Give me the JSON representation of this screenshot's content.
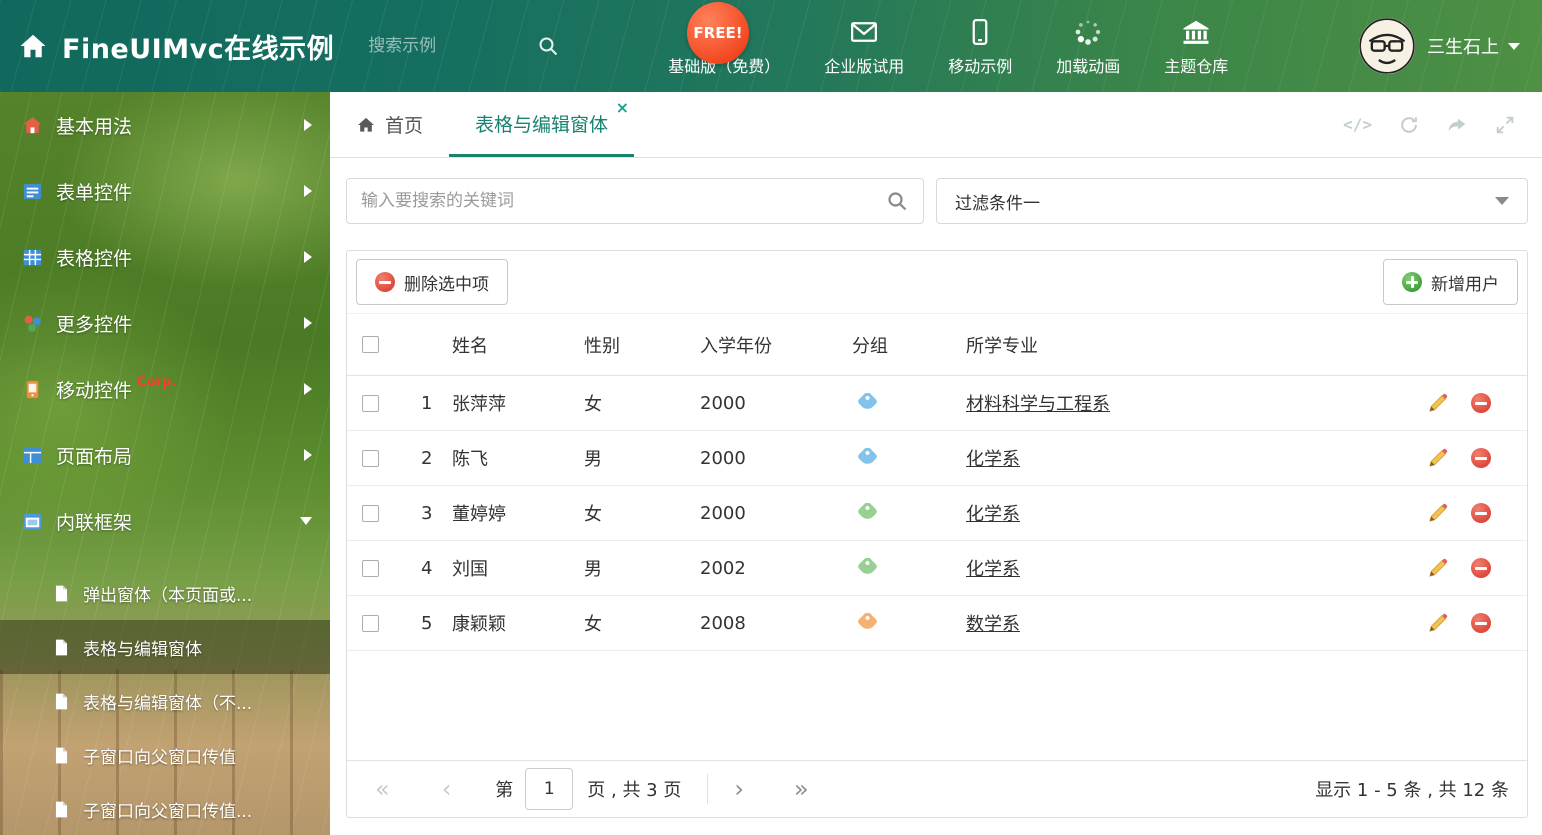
{
  "colors": {
    "accent": "#18836f",
    "header_green": "#156e60",
    "delete_red": "#dd4538",
    "add_green": "#46a443"
  },
  "header": {
    "title": "FineUIMvc在线示例",
    "search_placeholder": "搜索示例",
    "free_badge": "FREE!",
    "menu": [
      {
        "label": "基础版（免费）",
        "icon": "download-icon"
      },
      {
        "label": "企业版试用",
        "icon": "envelope-icon"
      },
      {
        "label": "移动示例",
        "icon": "mobile-icon"
      },
      {
        "label": "加载动画",
        "icon": "spinner-icon"
      },
      {
        "label": "主题仓库",
        "icon": "bank-icon"
      }
    ],
    "user": {
      "name": "三生石上"
    }
  },
  "sidebar": {
    "items": [
      {
        "label": "基本用法",
        "icon": "home-icon"
      },
      {
        "label": "表单控件",
        "icon": "form-icon"
      },
      {
        "label": "表格控件",
        "icon": "table-icon"
      },
      {
        "label": "更多控件",
        "icon": "widgets-icon"
      },
      {
        "label": "移动控件",
        "icon": "mobile-icon",
        "badge": "Corp."
      },
      {
        "label": "页面布局",
        "icon": "layout-icon"
      },
      {
        "label": "内联框架",
        "icon": "iframe-icon"
      }
    ],
    "subitems": [
      {
        "label": "弹出窗体（本页面或..."
      },
      {
        "label": "表格与编辑窗体"
      },
      {
        "label": "表格与编辑窗体（不..."
      },
      {
        "label": "子窗口向父窗口传值"
      },
      {
        "label": "子窗口向父窗口传值..."
      }
    ]
  },
  "tabs": {
    "home": "首页",
    "active": "表格与编辑窗体",
    "close_glyph": "×",
    "code_glyph": "</>",
    "tools": [
      "code-icon",
      "refresh-icon",
      "share-icon",
      "fullscreen-icon"
    ]
  },
  "filters": {
    "search_placeholder": "输入要搜索的关键词",
    "filter_value": "过滤条件一"
  },
  "toolbar": {
    "delete_label": "删除选中项",
    "add_label": "新增用户"
  },
  "table": {
    "headers": {
      "name": "姓名",
      "gender": "性别",
      "year": "入学年份",
      "group": "分组",
      "major": "所学专业"
    },
    "rows": [
      {
        "index": "1",
        "name": "张萍萍",
        "gender": "女",
        "year": "2000",
        "tag_color": "#82c3ec",
        "major": "材料科学与工程系"
      },
      {
        "index": "2",
        "name": "陈飞",
        "gender": "男",
        "year": "2000",
        "tag_color": "#82c3ec",
        "major": "化学系"
      },
      {
        "index": "3",
        "name": "董婷婷",
        "gender": "女",
        "year": "2000",
        "tag_color": "#98d093",
        "major": "化学系"
      },
      {
        "index": "4",
        "name": "刘国",
        "gender": "男",
        "year": "2002",
        "tag_color": "#98d093",
        "major": "化学系"
      },
      {
        "index": "5",
        "name": "康颖颖",
        "gender": "女",
        "year": "2008",
        "tag_color": "#f4b270",
        "major": "数学系"
      }
    ]
  },
  "pagination": {
    "first_glyph": "«",
    "prev_glyph": "‹",
    "next_glyph": "›",
    "last_glyph": "»",
    "page_prefix": "第",
    "current_page": "1",
    "page_suffix": "页 , 共 3 页",
    "summary": "显示 1 - 5 条 , 共 12 条"
  }
}
